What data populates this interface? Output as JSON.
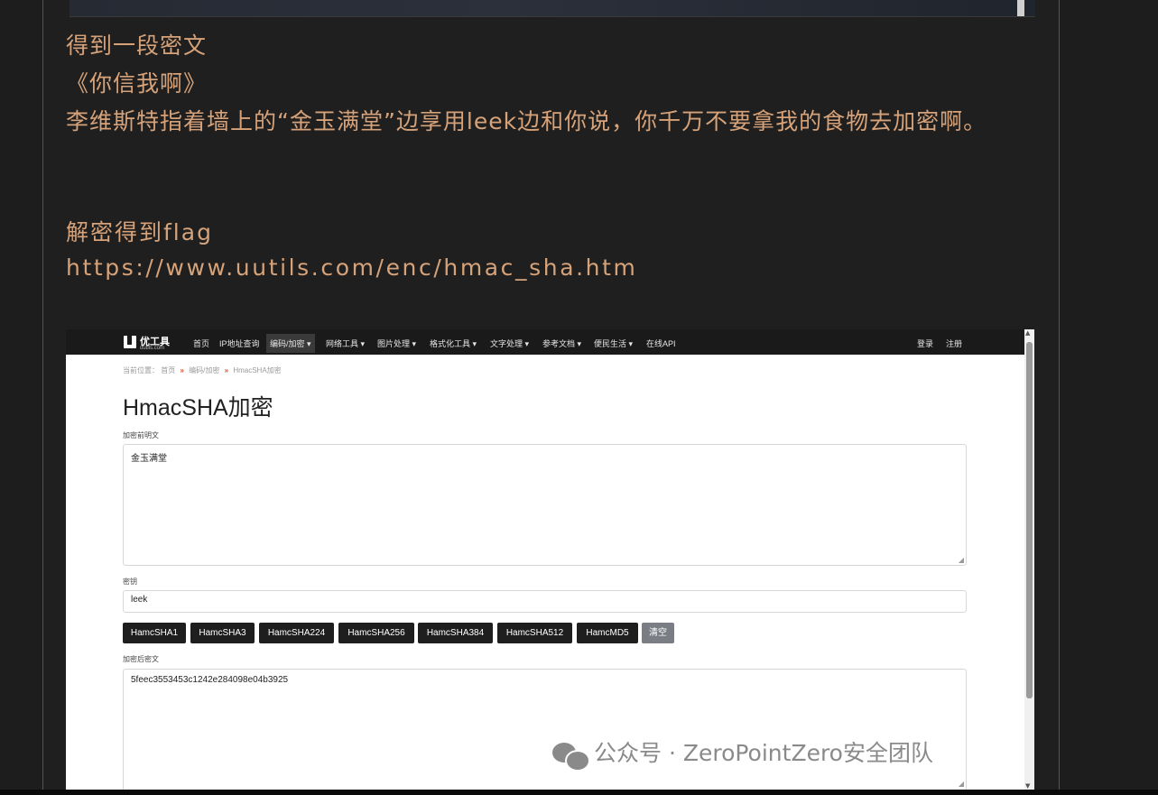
{
  "article": {
    "line1": "得到一段密文",
    "line2": "《你信我啊》",
    "line3": "李维斯特指着墙上的“金玉满堂”边享用leek边和你说，你千万不要拿我的食物去加密啊。",
    "line4": "解密得到flag",
    "line5": "https://www.uutils.com/enc/hmac_sha.htm"
  },
  "screenshot": {
    "logo": {
      "name": "优工具",
      "domain": "uutils.com"
    },
    "nav": {
      "items": [
        "首页",
        "IP地址查询",
        "编码/加密 ▾",
        "网络工具 ▾",
        "图片处理 ▾",
        "格式化工具 ▾",
        "文字处理 ▾",
        "参考文档 ▾",
        "便民生活 ▾",
        "在线API"
      ],
      "login": "登录",
      "register": "注册"
    },
    "breadcrumb": {
      "prefix": "当前位置：",
      "home": "首页",
      "category": "编码/加密",
      "current": "HmacSHA加密",
      "sep": "»"
    },
    "title": "HmacSHA加密",
    "plaintext_label": "加密前明文",
    "plaintext_value": "金玉满堂",
    "key_label": "密钥",
    "key_value": "leek",
    "buttons": [
      "HamcSHA1",
      "HamcSHA3",
      "HamcSHA224",
      "HamcSHA256",
      "HamcSHA384",
      "HamcSHA512",
      "HamcMD5",
      "清空"
    ],
    "result_label": "加密后密文",
    "result_value": "5feec3553453c1242e284098e04b3925"
  },
  "watermark": "公众号 · ZeroPointZero安全团队",
  "colors": {
    "article_text": "#d6a279",
    "page_bg": "#1d1d1d",
    "nav_bg": "#1a1a1a",
    "button_bg": "#1e1e1e",
    "clear_button_bg": "#7a7e84",
    "breadcrumb_sep": "#d04a2a"
  }
}
